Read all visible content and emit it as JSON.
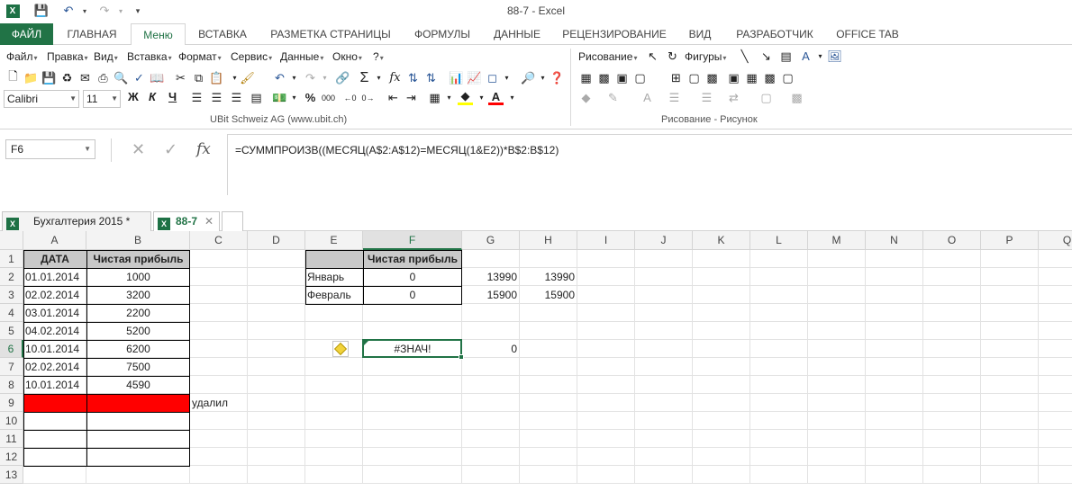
{
  "window": {
    "title": "88-7 - Excel"
  },
  "ribbon_tabs": [
    "ФАЙЛ",
    "ГЛАВНАЯ",
    "Меню",
    "ВСТАВКА",
    "РАЗМЕТКА СТРАНИЦЫ",
    "ФОРМУЛЫ",
    "ДАННЫЕ",
    "РЕЦЕНЗИРОВАНИЕ",
    "ВИД",
    "РАЗРАБОТЧИК",
    "OFFICE TAB"
  ],
  "active_tab": "Меню",
  "classic_menu": [
    "Файл",
    "Правка",
    "Вид",
    "Вставка",
    "Формат",
    "Сервис",
    "Данные",
    "Окно",
    "?"
  ],
  "drawing_menu": {
    "drawing": "Рисование",
    "shapes": "Фигуры"
  },
  "font": {
    "name": "Calibri",
    "size": "11"
  },
  "format_buttons": {
    "bold": "Ж",
    "italic": "К",
    "underline": "Ч"
  },
  "group_labels": {
    "left": "UBit Schweiz AG   (www.ubit.ch)",
    "right": "Рисование - Рисунок"
  },
  "formula_bar": {
    "name_box": "F6",
    "fx": "fx",
    "formula": "=СУММПРОИЗВ((МЕСЯЦ(A$2:A$12)=МЕСЯЦ(1&E2))*B$2:B$12)"
  },
  "workbook_tabs": [
    {
      "label": "Бухгалтерия 2015 *",
      "active": false
    },
    {
      "label": "88-7",
      "active": true
    }
  ],
  "sheet": {
    "columns": [
      "A",
      "B",
      "C",
      "D",
      "E",
      "F",
      "G",
      "H",
      "I",
      "J",
      "K",
      "L",
      "M",
      "N",
      "O",
      "P",
      "Q"
    ],
    "rows": [
      "1",
      "2",
      "3",
      "4",
      "5",
      "6",
      "7",
      "8",
      "9",
      "10",
      "11",
      "12",
      "13"
    ],
    "selected_cell": "F6",
    "table_headers": {
      "date": "ДАТА",
      "profit": "Чистая прибыль"
    },
    "entries": [
      {
        "date": "01.01.2014",
        "profit": "1000"
      },
      {
        "date": "02.02.2014",
        "profit": "3200"
      },
      {
        "date": "03.01.2014",
        "profit": "2200"
      },
      {
        "date": "04.02.2014",
        "profit": "5200"
      },
      {
        "date": "10.01.2014",
        "profit": "6200"
      },
      {
        "date": "02.02.2014",
        "profit": "7500"
      },
      {
        "date": "10.01.2014",
        "profit": "4590"
      }
    ],
    "note_c9": "удалил",
    "summary_header": "Чистая прибыль",
    "summary": [
      {
        "month": "Январь",
        "f": "0",
        "g": "13990",
        "h": "13990"
      },
      {
        "month": "Февраль",
        "f": "0",
        "g": "15900",
        "h": "15900"
      }
    ],
    "f6": "#ЗНАЧ!",
    "g6": "0"
  }
}
